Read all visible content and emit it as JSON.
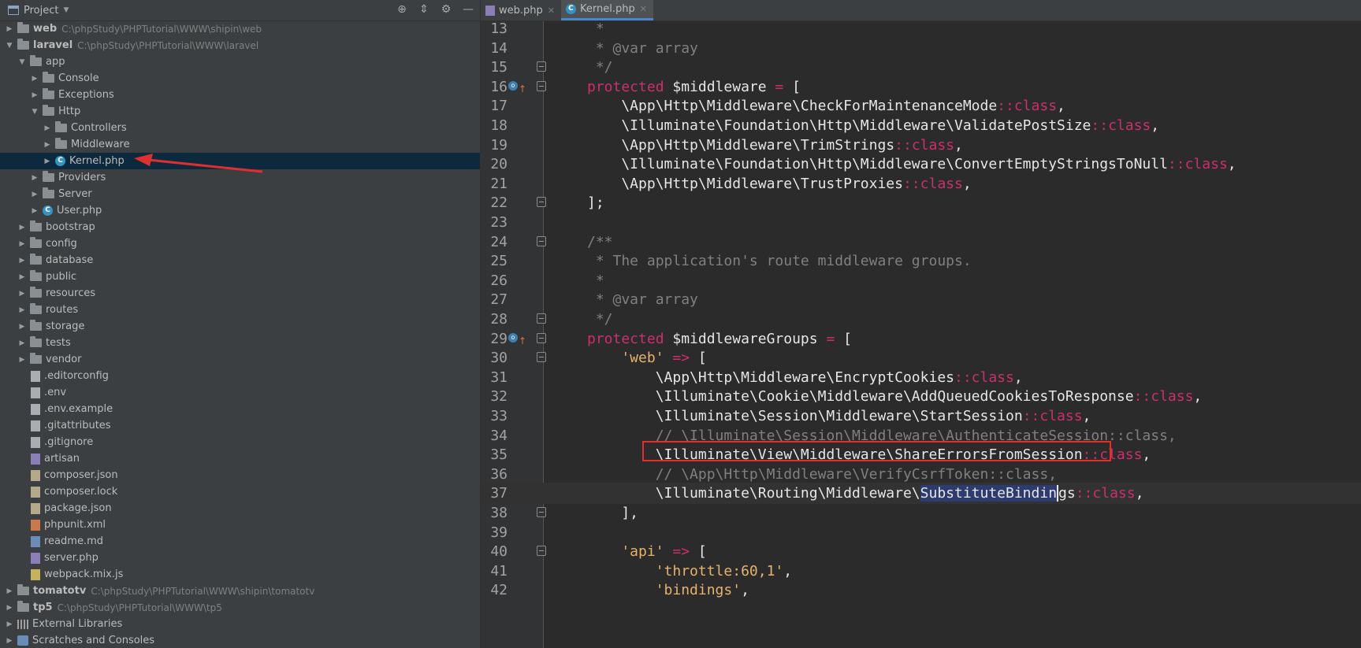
{
  "sidebar": {
    "header": {
      "title": "Project",
      "tools": [
        {
          "icon": "target-icon",
          "glyph": "⊕"
        },
        {
          "icon": "collapse-icon",
          "glyph": "⇕"
        },
        {
          "icon": "gear-icon",
          "glyph": "⚙"
        },
        {
          "icon": "minimize-icon",
          "glyph": "—"
        }
      ]
    },
    "tree": [
      {
        "label": "web",
        "path": "C:\\phpStudy\\PHPTutorial\\WWW\\shipin\\web",
        "bold": true,
        "level": 0,
        "arrow": "▶",
        "icon": "folder"
      },
      {
        "label": "laravel",
        "path": "C:\\phpStudy\\PHPTutorial\\WWW\\laravel",
        "bold": true,
        "level": 0,
        "arrow": "▼",
        "icon": "folder"
      },
      {
        "label": "app",
        "level": 1,
        "arrow": "▼",
        "icon": "folder"
      },
      {
        "label": "Console",
        "level": 2,
        "arrow": "▶",
        "icon": "folder"
      },
      {
        "label": "Exceptions",
        "level": 2,
        "arrow": "▶",
        "icon": "folder"
      },
      {
        "label": "Http",
        "level": 2,
        "arrow": "▼",
        "icon": "folder"
      },
      {
        "label": "Controllers",
        "level": 3,
        "arrow": "▶",
        "icon": "folder"
      },
      {
        "label": "Middleware",
        "level": 3,
        "arrow": "▶",
        "icon": "folder"
      },
      {
        "label": "Kernel.php",
        "level": 3,
        "arrow": "▶",
        "icon": "php-class",
        "selected": true
      },
      {
        "label": "Providers",
        "level": 2,
        "arrow": "▶",
        "icon": "folder"
      },
      {
        "label": "Server",
        "level": 2,
        "arrow": "▶",
        "icon": "folder"
      },
      {
        "label": "User.php",
        "level": 2,
        "arrow": "▶",
        "icon": "php-class"
      },
      {
        "label": "bootstrap",
        "level": 1,
        "arrow": "▶",
        "icon": "folder"
      },
      {
        "label": "config",
        "level": 1,
        "arrow": "▶",
        "icon": "folder"
      },
      {
        "label": "database",
        "level": 1,
        "arrow": "▶",
        "icon": "folder"
      },
      {
        "label": "public",
        "level": 1,
        "arrow": "▶",
        "icon": "folder"
      },
      {
        "label": "resources",
        "level": 1,
        "arrow": "▶",
        "icon": "folder"
      },
      {
        "label": "routes",
        "level": 1,
        "arrow": "▶",
        "icon": "folder"
      },
      {
        "label": "storage",
        "level": 1,
        "arrow": "▶",
        "icon": "folder"
      },
      {
        "label": "tests",
        "level": 1,
        "arrow": "▶",
        "icon": "folder"
      },
      {
        "label": "vendor",
        "level": 1,
        "arrow": "▶",
        "icon": "folder"
      },
      {
        "label": ".editorconfig",
        "level": 1,
        "icon": "file-lines"
      },
      {
        "label": ".env",
        "level": 1,
        "icon": "file-lines"
      },
      {
        "label": ".env.example",
        "level": 1,
        "icon": "file-lines"
      },
      {
        "label": ".gitattributes",
        "level": 1,
        "icon": "file-lines"
      },
      {
        "label": ".gitignore",
        "level": 1,
        "icon": "file-lines"
      },
      {
        "label": "artisan",
        "level": 1,
        "icon": "file-art"
      },
      {
        "label": "composer.json",
        "level": 1,
        "icon": "file-json"
      },
      {
        "label": "composer.lock",
        "level": 1,
        "icon": "file-json"
      },
      {
        "label": "package.json",
        "level": 1,
        "icon": "file-json"
      },
      {
        "label": "phpunit.xml",
        "level": 1,
        "icon": "file-xml"
      },
      {
        "label": "readme.md",
        "level": 1,
        "icon": "file-md"
      },
      {
        "label": "server.php",
        "level": 1,
        "icon": "file-php"
      },
      {
        "label": "webpack.mix.js",
        "level": 1,
        "icon": "file-js"
      },
      {
        "label": "tomatotv",
        "path": "C:\\phpStudy\\PHPTutorial\\WWW\\shipin\\tomatotv",
        "bold": true,
        "level": 0,
        "arrow": "▶",
        "icon": "folder"
      },
      {
        "label": "tp5",
        "path": "C:\\phpStudy\\PHPTutorial\\WWW\\tp5",
        "bold": true,
        "level": 0,
        "arrow": "▶",
        "icon": "folder"
      },
      {
        "label": "External Libraries",
        "level": 0,
        "arrow": "▶",
        "icon": "library"
      },
      {
        "label": "Scratches and Consoles",
        "level": 0,
        "arrow": "▶",
        "icon": "scratch"
      }
    ]
  },
  "editor": {
    "tabs": [
      {
        "label": "web.php",
        "active": false,
        "icon": "php-file"
      },
      {
        "label": "Kernel.php",
        "active": true,
        "icon": "php-class"
      }
    ],
    "lines": [
      {
        "n": "13",
        "segs": [
          [
            "cm",
            " *"
          ]
        ]
      },
      {
        "n": "14",
        "segs": [
          [
            "cm",
            " * @var array"
          ]
        ]
      },
      {
        "n": "15",
        "fold": true,
        "segs": [
          [
            "cm",
            " */"
          ]
        ]
      },
      {
        "n": "16",
        "fold": true,
        "override": true,
        "segs": [
          [
            "kw",
            "protected "
          ],
          [
            "var",
            "$middleware "
          ],
          [
            "op",
            "= "
          ],
          [
            "var",
            "["
          ]
        ]
      },
      {
        "n": "17",
        "segs": [
          [
            "var",
            "    \\App\\Http\\Middleware\\CheckForMaintenanceMode"
          ],
          [
            "cls",
            "::class"
          ],
          [
            "var",
            ","
          ]
        ]
      },
      {
        "n": "18",
        "segs": [
          [
            "var",
            "    \\Illuminate\\Foundation\\Http\\Middleware\\ValidatePostSize"
          ],
          [
            "cls",
            "::class"
          ],
          [
            "var",
            ","
          ]
        ]
      },
      {
        "n": "19",
        "segs": [
          [
            "var",
            "    \\App\\Http\\Middleware\\TrimStrings"
          ],
          [
            "cls",
            "::class"
          ],
          [
            "var",
            ","
          ]
        ]
      },
      {
        "n": "20",
        "segs": [
          [
            "var",
            "    \\Illuminate\\Foundation\\Http\\Middleware\\ConvertEmptyStringsToNull"
          ],
          [
            "cls",
            "::class"
          ],
          [
            "var",
            ","
          ]
        ]
      },
      {
        "n": "21",
        "segs": [
          [
            "var",
            "    \\App\\Http\\Middleware\\TrustProxies"
          ],
          [
            "cls",
            "::class"
          ],
          [
            "var",
            ","
          ]
        ]
      },
      {
        "n": "22",
        "fold": true,
        "segs": [
          [
            "var",
            "];"
          ]
        ]
      },
      {
        "n": "23",
        "segs": []
      },
      {
        "n": "24",
        "fold": true,
        "segs": [
          [
            "cm",
            "/**"
          ]
        ]
      },
      {
        "n": "25",
        "segs": [
          [
            "cm",
            " * The application's route middleware groups."
          ]
        ]
      },
      {
        "n": "26",
        "segs": [
          [
            "cm",
            " *"
          ]
        ]
      },
      {
        "n": "27",
        "segs": [
          [
            "cm",
            " * @var array"
          ]
        ]
      },
      {
        "n": "28",
        "fold": true,
        "segs": [
          [
            "cm",
            " */"
          ]
        ]
      },
      {
        "n": "29",
        "fold": true,
        "override": true,
        "segs": [
          [
            "kw",
            "protected "
          ],
          [
            "var",
            "$middlewareGroups "
          ],
          [
            "op",
            "= "
          ],
          [
            "var",
            "["
          ]
        ]
      },
      {
        "n": "30",
        "fold": true,
        "segs": [
          [
            "str",
            "    'web' "
          ],
          [
            "op",
            "=> "
          ],
          [
            "var",
            "["
          ]
        ]
      },
      {
        "n": "31",
        "segs": [
          [
            "var",
            "        \\App\\Http\\Middleware\\EncryptCookies"
          ],
          [
            "cls",
            "::class"
          ],
          [
            "var",
            ","
          ]
        ]
      },
      {
        "n": "32",
        "segs": [
          [
            "var",
            "        \\Illuminate\\Cookie\\Middleware\\AddQueuedCookiesToResponse"
          ],
          [
            "cls",
            "::class"
          ],
          [
            "var",
            ","
          ]
        ]
      },
      {
        "n": "33",
        "segs": [
          [
            "var",
            "        \\Illuminate\\Session\\Middleware\\StartSession"
          ],
          [
            "cls",
            "::class"
          ],
          [
            "var",
            ","
          ]
        ]
      },
      {
        "n": "34",
        "segs": [
          [
            "cm",
            "        // \\Illuminate\\Session\\Middleware\\AuthenticateSession::class,"
          ]
        ]
      },
      {
        "n": "35",
        "segs": [
          [
            "var",
            "        \\Illuminate\\View\\Middleware\\ShareErrorsFromSession"
          ],
          [
            "cls",
            "::class"
          ],
          [
            "var",
            ","
          ]
        ]
      },
      {
        "n": "36",
        "segs": [
          [
            "cm",
            "        // \\App\\Http\\Middleware\\VerifyCsrfToken::class,"
          ]
        ]
      },
      {
        "n": "37",
        "current": true,
        "segs": [
          [
            "var",
            "        \\Illuminate\\Routing\\Middleware\\"
          ],
          [
            "hl",
            "SubstituteBindin"
          ],
          [
            "caret",
            "gs"
          ],
          [
            "cls",
            "::class"
          ],
          [
            "var",
            ","
          ]
        ]
      },
      {
        "n": "38",
        "fold": true,
        "segs": [
          [
            "var",
            "    ],"
          ]
        ]
      },
      {
        "n": "39",
        "segs": []
      },
      {
        "n": "40",
        "fold": true,
        "segs": [
          [
            "str",
            "    'api' "
          ],
          [
            "op",
            "=> "
          ],
          [
            "var",
            "["
          ]
        ]
      },
      {
        "n": "41",
        "segs": [
          [
            "str",
            "        'throttle:60,1'"
          ],
          [
            "var",
            ","
          ]
        ]
      },
      {
        "n": "42",
        "segs": [
          [
            "str",
            "        'bindings'"
          ],
          [
            "var",
            ","
          ]
        ]
      }
    ]
  },
  "colors": {
    "accent": "#4a88c7",
    "keyword": "#cc2f6e",
    "comment": "#808080",
    "string": "#e7b26c",
    "annotation_red": "#e02f2f"
  }
}
